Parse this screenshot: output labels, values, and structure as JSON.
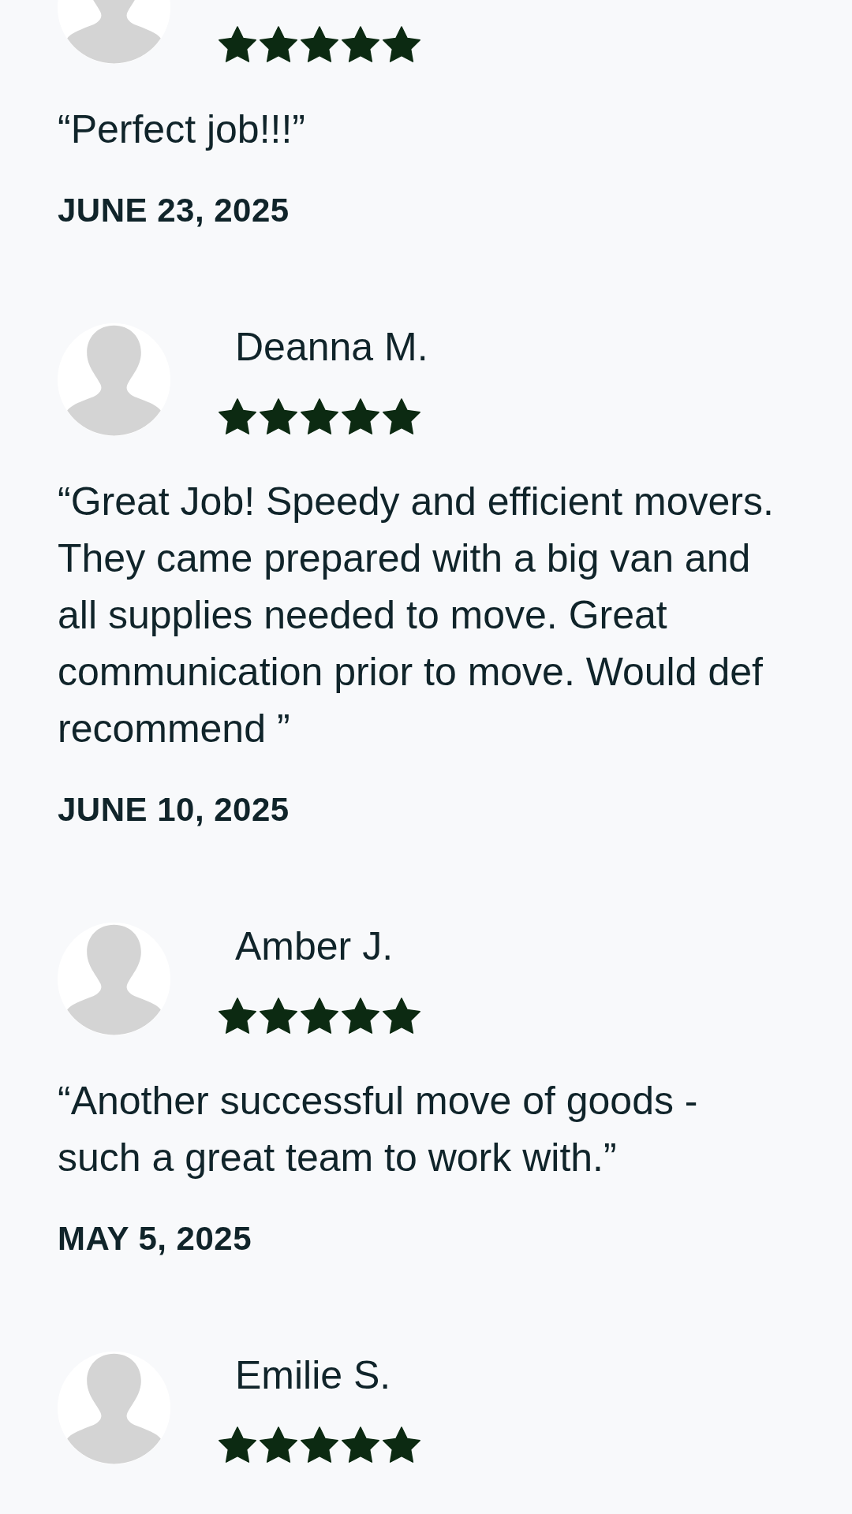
{
  "reviews": [
    {
      "stars": 5,
      "quote": "“Perfect job!!!”",
      "date": "JUNE 23, 2025"
    },
    {
      "name": "Deanna M.",
      "stars": 5,
      "quote": "“Great Job! Speedy and efficient movers. They came prepared with a big van and all supplies needed to move. Great communication prior to move. Would def recommend ”",
      "date": "JUNE 10, 2025"
    },
    {
      "name": "Amber J.",
      "stars": 5,
      "quote": "“Another successful move of goods - such a great team to work with.”",
      "date": "MAY 5, 2025"
    },
    {
      "name": "Emilie S.",
      "stars": 5
    }
  ]
}
